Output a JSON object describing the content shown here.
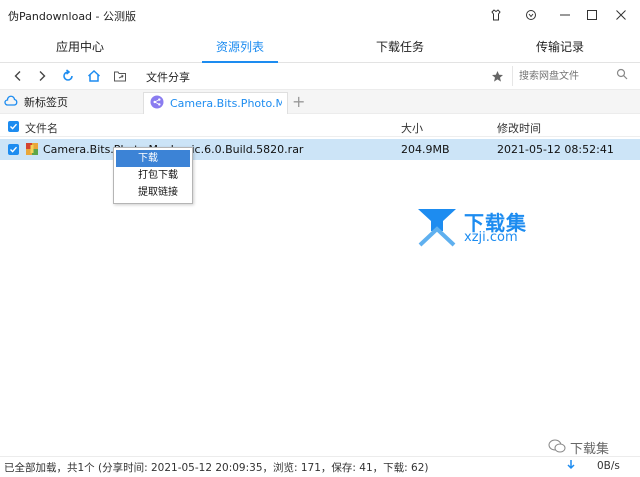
{
  "window": {
    "title": "伪Pandownload - 公测版"
  },
  "tabs": [
    {
      "label": "应用中心",
      "active": false
    },
    {
      "label": "资源列表",
      "active": true
    },
    {
      "label": "下载任务",
      "active": false
    },
    {
      "label": "传输记录",
      "active": false
    }
  ],
  "toolbar": {
    "path_label": "文件分享",
    "search_placeholder": "搜索网盘文件"
  },
  "pagebar": {
    "new_tab_label": "新标签页",
    "doc_tab_label": "Camera.Bits.Photo.M..."
  },
  "table": {
    "headers": {
      "name": "文件名",
      "size": "大小",
      "modified": "修改时间"
    },
    "rows": [
      {
        "name": "Camera.Bits.Photo.Mechanic.6.0.Build.5820.rar",
        "size": "204.9MB",
        "modified": "2021-05-12 08:52:41",
        "selected": true
      }
    ]
  },
  "context_menu": {
    "items": [
      "下载",
      "打包下载",
      "提取链接"
    ],
    "highlighted_index": 0
  },
  "watermark": {
    "brand": "下载集",
    "domain": "xzji.com",
    "wechat_label": "下载集"
  },
  "status": {
    "text": "已全部加载，共1个 (分享时间: 2021-05-12 20:09:35，浏览: 171，保存: 41，下载: 62)",
    "speed": "0B/s"
  },
  "colors": {
    "accent": "#1d8cf0",
    "row_selected": "#cce4f7",
    "menu_highlight": "#3c83d6"
  }
}
